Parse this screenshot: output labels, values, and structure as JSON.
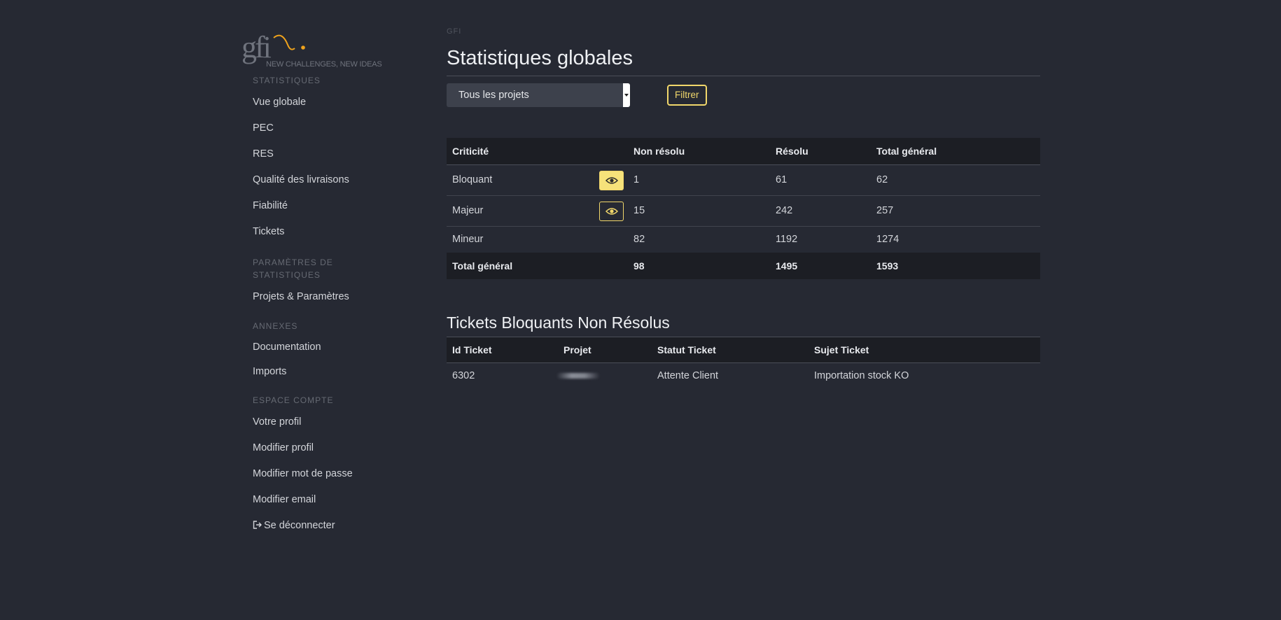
{
  "brand": {
    "logo_text": "gfi",
    "tagline": "NEW CHALLENGES, NEW IDEAS",
    "accent_color": "#f0a31c"
  },
  "sidebar": {
    "sections": [
      {
        "heading": "STATISTIQUES",
        "items": [
          "Vue globale",
          "PEC",
          "RES",
          "Qualité des livraisons",
          "Fiabilité",
          "Tickets"
        ]
      },
      {
        "heading": "PARAMÈTRES DE STATISTIQUES",
        "items": [
          "Projets & Paramètres"
        ]
      },
      {
        "heading": "ANNEXES",
        "items": [
          "Documentation",
          "Imports"
        ]
      },
      {
        "heading": "ESPACE COMPTE",
        "items": [
          "Votre profil",
          "Modifier profil",
          "Modifier mot de passe",
          "Modifier email",
          "Se déconnecter"
        ]
      }
    ]
  },
  "main": {
    "breadcrumb": "GFI",
    "title": "Statistiques globales",
    "filter": {
      "selected_project": "Tous les projets",
      "button_label": "Filtrer"
    },
    "stats_table": {
      "headers": [
        "Criticité",
        "Non résolu",
        "Résolu",
        "Total général"
      ],
      "rows": [
        {
          "label": "Bloquant",
          "unresolved": "1",
          "resolved": "61",
          "total": "62",
          "eye": "eye-icon"
        },
        {
          "label": "Majeur",
          "unresolved": "15",
          "resolved": "242",
          "total": "257",
          "eye": "eye-icon"
        },
        {
          "label": "Mineur",
          "unresolved": "82",
          "resolved": "1192",
          "total": "1274"
        }
      ],
      "total_row": {
        "label": "Total général",
        "unresolved": "98",
        "resolved": "1495",
        "total": "1593"
      }
    },
    "tickets_section": {
      "title": "Tickets Bloquants Non Résolus",
      "headers": [
        "Id Ticket",
        "Projet",
        "Statut Ticket",
        "Sujet Ticket"
      ],
      "rows": [
        {
          "id": "6302",
          "status": "Attente Client",
          "subject": "Importation stock KO"
        }
      ]
    }
  },
  "colors": {
    "background": "#262933",
    "table_header": "#1c1e24",
    "highlight": "#f1d76b"
  }
}
